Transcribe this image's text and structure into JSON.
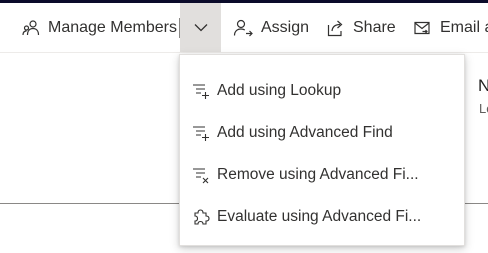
{
  "toolbar": {
    "manage_members": {
      "label": "Manage Members",
      "icon": "people-icon"
    },
    "split_dropdown": {
      "icon": "chevron-down-icon"
    },
    "assign": {
      "label": "Assign",
      "icon": "person-assign-icon"
    },
    "share": {
      "label": "Share",
      "icon": "share-icon"
    },
    "email": {
      "label": "Email a",
      "icon": "email-link-icon"
    }
  },
  "menu": {
    "items": [
      {
        "label": "Add using Lookup",
        "icon": "add-list-icon"
      },
      {
        "label": "Add using Advanced Find",
        "icon": "add-list-icon"
      },
      {
        "label": "Remove using Advanced Fi...",
        "icon": "remove-list-icon"
      },
      {
        "label": "Evaluate using Advanced Fi...",
        "icon": "puzzle-icon"
      }
    ]
  },
  "background": {
    "peek_title": "N",
    "peek_sub": "Lo"
  },
  "colors": {
    "accent_dark": "#0b0b2a",
    "pressed_bg": "#e1dfdd",
    "text": "#323130"
  }
}
